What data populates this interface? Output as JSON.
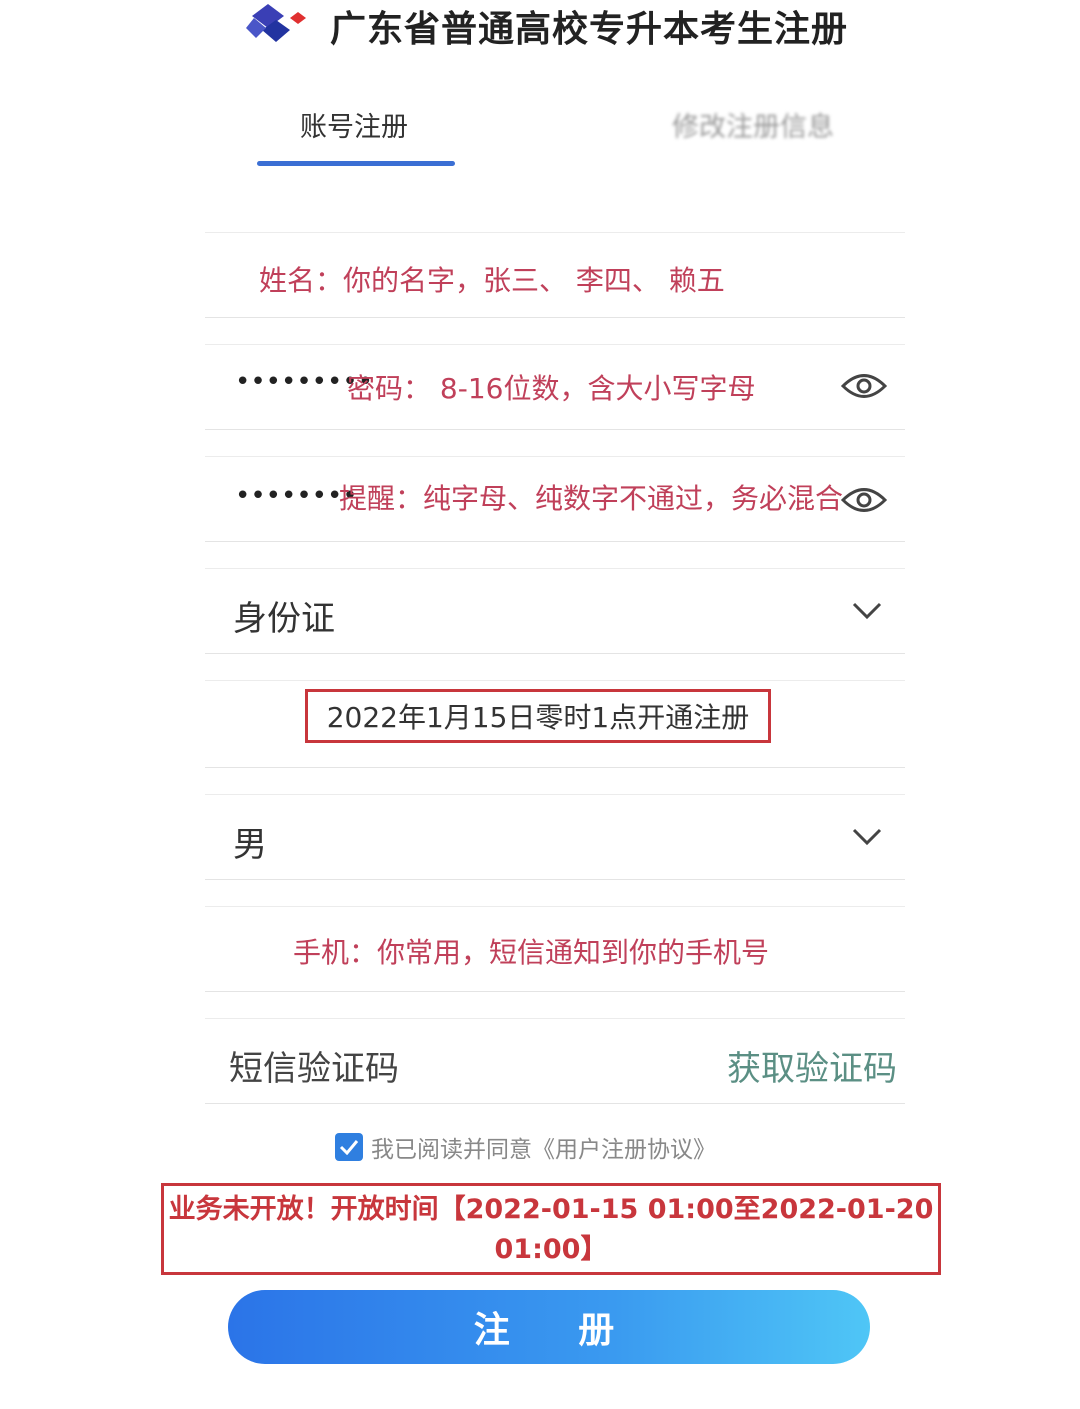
{
  "header": {
    "title": "广东省普通高校专升本考生注册"
  },
  "tabs": [
    {
      "label": "账号注册",
      "active": true
    },
    {
      "label": "修改注册信息",
      "active": false
    }
  ],
  "form": {
    "name_placeholder": "姓名：你的名字，张三、 李四、 赖五",
    "password_mask": "•••••••••",
    "password_placeholder": "密码： 8-16位数，含大小写字母",
    "confirm_mask": "••••••••",
    "confirm_placeholder": "提醒：纯字母、纯数字不通过，务必混合",
    "id_type_value": "身份证",
    "id_notice": "2022年1月15日零时1点开通注册",
    "gender_value": "男",
    "phone_placeholder": "手机：你常用，短信通知到你的手机号",
    "sms_placeholder": "短信验证码",
    "sms_button": "获取验证码"
  },
  "agreement": {
    "text": "我已阅读并同意《用户注册协议》",
    "checked": true
  },
  "warning": {
    "line1": "业务未开放！开放时间【2022-01-15 01:00至2022-01-20",
    "line2": "01:00】"
  },
  "register_button": "注 册",
  "colors": {
    "accent": "#3b6fd4",
    "warning": "#c8363c",
    "hint": "#c0405a"
  }
}
